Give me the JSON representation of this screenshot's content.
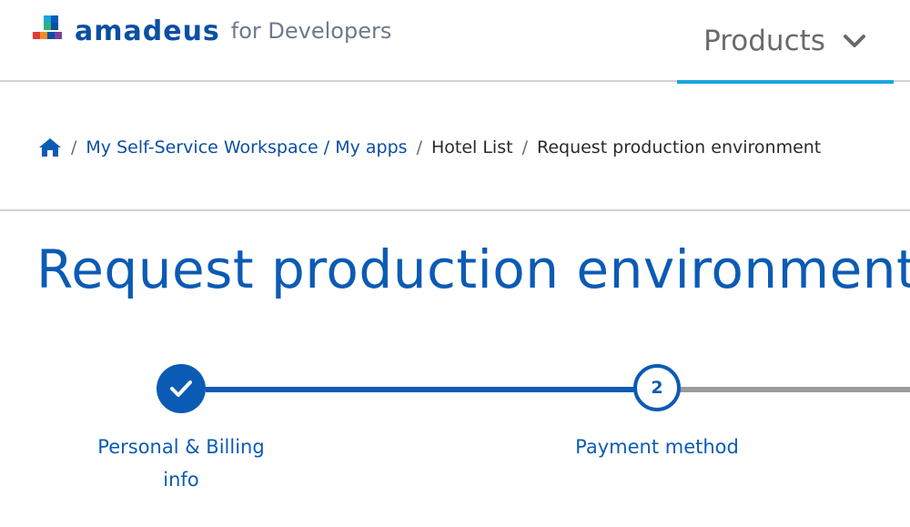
{
  "header": {
    "logo_text": "amadeus",
    "logo_sub": "for Developers",
    "nav": {
      "products_label": "Products"
    }
  },
  "breadcrumb": {
    "items": [
      {
        "label": "My Self-Service Workspace / My apps"
      },
      {
        "label": "Hotel List"
      },
      {
        "label": "Request production environment"
      }
    ],
    "separator": "/"
  },
  "page": {
    "title": "Request production environment"
  },
  "stepper": {
    "steps": [
      {
        "label": "Personal & Billing info",
        "state": "completed",
        "icon": "check-icon"
      },
      {
        "label": "Payment method",
        "state": "active",
        "number": "2"
      }
    ]
  },
  "colors": {
    "primary": "#0b5bb5",
    "accent": "#1aa5dc",
    "inactive_line": "#9b9b9b"
  }
}
